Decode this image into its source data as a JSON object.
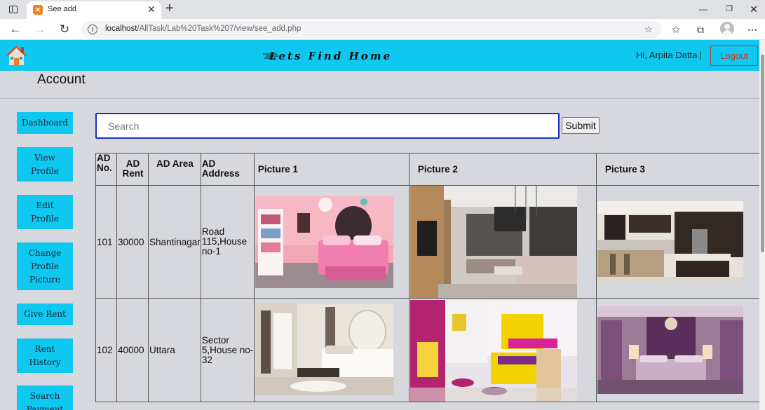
{
  "browser": {
    "tab_title": "See add",
    "url_host": "localhost",
    "url_path": "/AllTask/Lab%20Task%207/view/see_add.php"
  },
  "header": {
    "brand": "Lets Find Home",
    "greeting": "Hi, Arpita Datta",
    "separator": "|",
    "logout_label": "Logout"
  },
  "page_title": "Account",
  "sidebar": {
    "items": [
      {
        "label": "Dashboard"
      },
      {
        "label": "View Profile"
      },
      {
        "label": "Edit Profile"
      },
      {
        "label": "Change Profile Picture"
      },
      {
        "label": "Give Rent"
      },
      {
        "label": "Rent History"
      },
      {
        "label": "Search Payment"
      }
    ]
  },
  "search": {
    "placeholder": "Search",
    "submit_label": "Submit"
  },
  "table": {
    "headers": [
      "AD No.",
      "AD Rent",
      "AD Area",
      "AD Address",
      "Picture 1",
      "Picture 2",
      "Picture 3"
    ],
    "rows": [
      {
        "no": "101",
        "rent": "30000",
        "area": "Shantinagar",
        "address": "Road 115,House no-1",
        "pictures": [
          "pink-bedroom-photo",
          "living-room-photo",
          "kitchen-photo"
        ]
      },
      {
        "no": "102",
        "rent": "40000",
        "area": "Uttara",
        "address": "Sector 5,House no-32",
        "pictures": [
          "white-bedroom-photo",
          "kids-bunk-bedroom-photo",
          "purple-bedroom-photo"
        ]
      }
    ]
  },
  "colors": {
    "header_bg": "#0fc8ef",
    "page_bg": "#d6d8de",
    "logout": "#c0392b",
    "search_border": "#1b2fd1"
  }
}
